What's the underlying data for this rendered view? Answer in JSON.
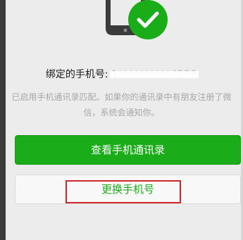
{
  "binding": {
    "label": "绑定的手机号:",
    "phone_masked": "1**********4229"
  },
  "note": "已启用手机通讯录匹配。如果你的通讯录中有朋友注册了微信，系统会通知你。",
  "buttons": {
    "view_contacts": "查看手机通讯录",
    "change_phone": "更换手机号"
  },
  "colors": {
    "accent_green": "#1aad19",
    "highlight_red": "#d1262b"
  },
  "icons": {
    "phone": "phone-icon",
    "check": "check-icon"
  }
}
